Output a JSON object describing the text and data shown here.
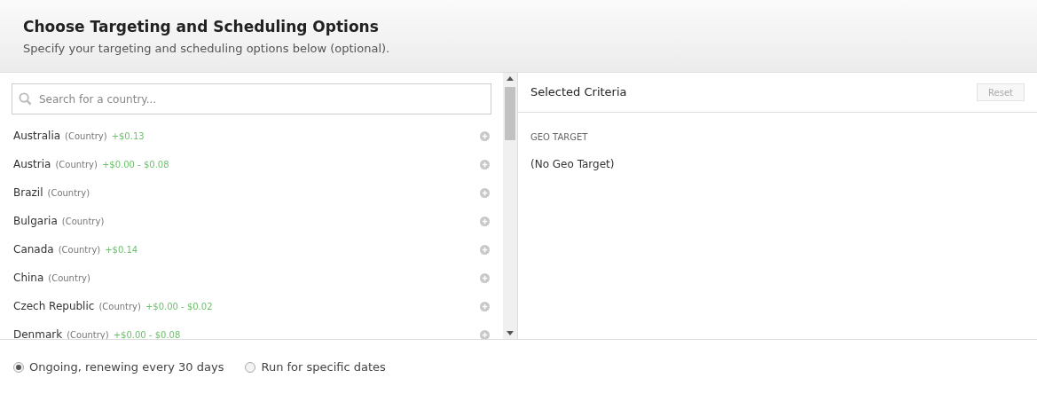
{
  "header": {
    "title": "Choose Targeting and Scheduling Options",
    "subtitle": "Specify your targeting and scheduling options below (optional)."
  },
  "search": {
    "placeholder": "Search for a country..."
  },
  "countries": [
    {
      "name": "Australia",
      "type": "(Country)",
      "price": "+$0.13"
    },
    {
      "name": "Austria",
      "type": "(Country)",
      "price": "+$0.00 - $0.08"
    },
    {
      "name": "Brazil",
      "type": "(Country)"
    },
    {
      "name": "Bulgaria",
      "type": "(Country)"
    },
    {
      "name": "Canada",
      "type": "(Country)",
      "price": "+$0.14"
    },
    {
      "name": "China",
      "type": "(Country)"
    },
    {
      "name": "Czech Republic",
      "type": "(Country)",
      "price": "+$0.00 - $0.02"
    },
    {
      "name": "Denmark",
      "type": "(Country)",
      "price": "+$0.00 - $0.08"
    }
  ],
  "criteria": {
    "title": "Selected Criteria",
    "reset": {
      "label": "Reset",
      "disabled": true
    },
    "section": "GEO TARGET",
    "value": "(No Geo Target)"
  },
  "schedule": [
    {
      "label": "Ongoing, renewing every 30 days",
      "selected": true
    },
    {
      "label": "Run for specific dates",
      "selected": false
    }
  ]
}
